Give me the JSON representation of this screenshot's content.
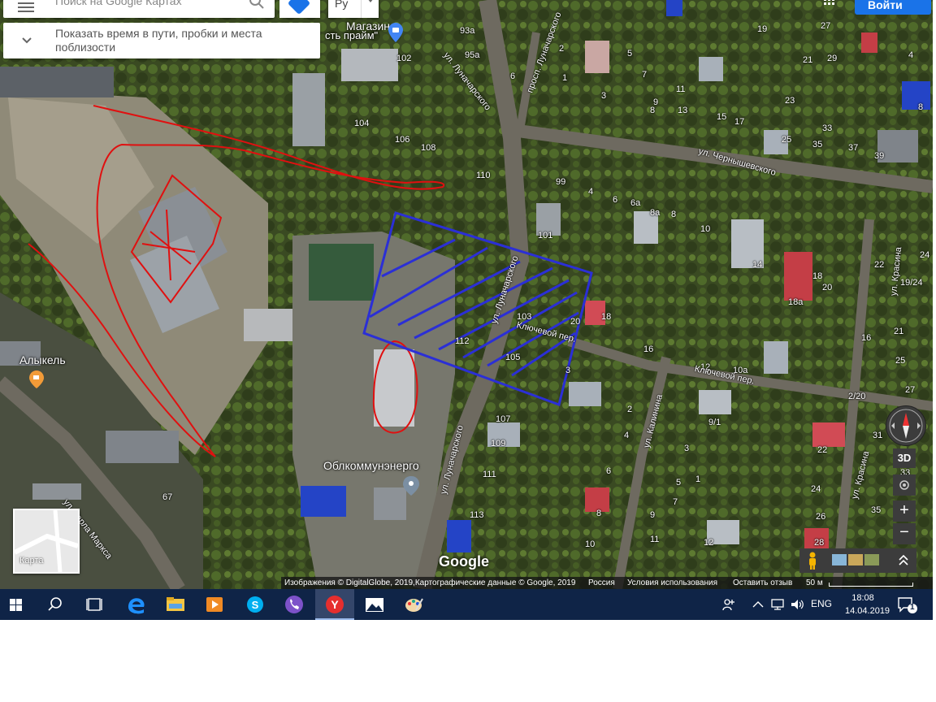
{
  "search": {
    "placeholder": "Поиск на Google Картах"
  },
  "language": {
    "selected": "Ру"
  },
  "tip": {
    "text": "Показать время в пути, пробки и места поблизости"
  },
  "signin": {
    "label": "Войти"
  },
  "controls": {
    "three_d": "3D",
    "zoom_in": "+",
    "zoom_out": "−"
  },
  "minimap": {
    "label": "Карта"
  },
  "google_logo": "Google",
  "attribution": {
    "imagery": "Изображения © DigitalGlobe, 2019,Картографические данные © Google, 2019",
    "country": "Россия",
    "terms": "Условия использования",
    "feedback": "Оставить отзыв",
    "scale": "50 м"
  },
  "pois": [
    {
      "name": "Магазин",
      "name2": "сть прайм\""
    },
    {
      "name": "Алыкель"
    },
    {
      "name": "Облкоммунэнерго"
    }
  ],
  "streets": [
    "ул. Луначарского",
    "просп. Луначарского",
    "ул. Чернышевского",
    "ул. Луначарского",
    "Ключевой пер.",
    "Ключевой пер.",
    "ул. Калинина",
    "ул. Красина",
    "ул. Красина",
    "ул. Луначарского",
    "ул. Карла Маркса"
  ],
  "house_numbers": [
    "93а",
    "95а",
    "102",
    "104",
    "106",
    "108",
    "110",
    "6",
    "1",
    "2",
    "3",
    "5",
    "7",
    "8",
    "9",
    "11",
    "13",
    "15",
    "17",
    "19",
    "21",
    "23",
    "25",
    "27",
    "29",
    "33",
    "35",
    "37",
    "39",
    "99",
    "4",
    "6",
    "6а",
    "8а",
    "8",
    "10",
    "101",
    "103",
    "105",
    "112",
    "20",
    "18",
    "16",
    "12",
    "10а",
    "14",
    "20",
    "18",
    "18а",
    "22",
    "24",
    "19/24",
    "21",
    "16",
    "25",
    "27",
    "2/20",
    "31",
    "33",
    "35",
    "26",
    "24",
    "22",
    "28",
    "107",
    "109",
    "111",
    "113",
    "9/1",
    "2",
    "4",
    "6",
    "8",
    "10",
    "7",
    "5",
    "3",
    "1",
    "9",
    "11",
    "12",
    "67",
    "8",
    "3",
    "4"
  ],
  "taskbar": {
    "language": "ENG",
    "time": "18:08",
    "date": "14.04.2019",
    "notifications": "1"
  },
  "colors": {
    "accent": "#1a73e8",
    "taskbar": "#0f2447",
    "red_annotation": "#e01010",
    "blue_annotation": "#2b2fd6"
  }
}
